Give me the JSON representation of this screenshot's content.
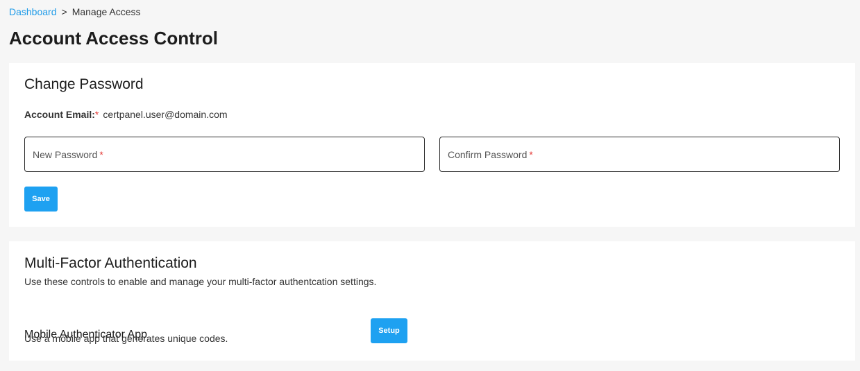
{
  "breadcrumb": {
    "dashboard": "Dashboard",
    "separator": ">",
    "current": "Manage Access"
  },
  "page_title": "Account Access Control",
  "change_password": {
    "title": "Change Password",
    "email_label": "Account Email:",
    "email_required_mark": "*",
    "email_value": "certpanel.user@domain.com",
    "new_password_label": "New Password",
    "new_password_required_mark": "*",
    "new_password_value": "",
    "confirm_password_label": "Confirm Password",
    "confirm_password_required_mark": "*",
    "confirm_password_value": "",
    "save_label": "Save"
  },
  "mfa": {
    "title": "Multi-Factor Authentication",
    "description": "Use these controls to enable and manage your multi-factor authentcation settings.",
    "app_title": "Mobile Authenticator App",
    "app_description": "Use a mobile app that generates unique codes.",
    "setup_label": "Setup"
  },
  "colors": {
    "accent": "#1ea1f1",
    "link": "#1e9be8",
    "required": "#e53935",
    "page_background": "#f6f6f6",
    "card_background": "#ffffff"
  }
}
